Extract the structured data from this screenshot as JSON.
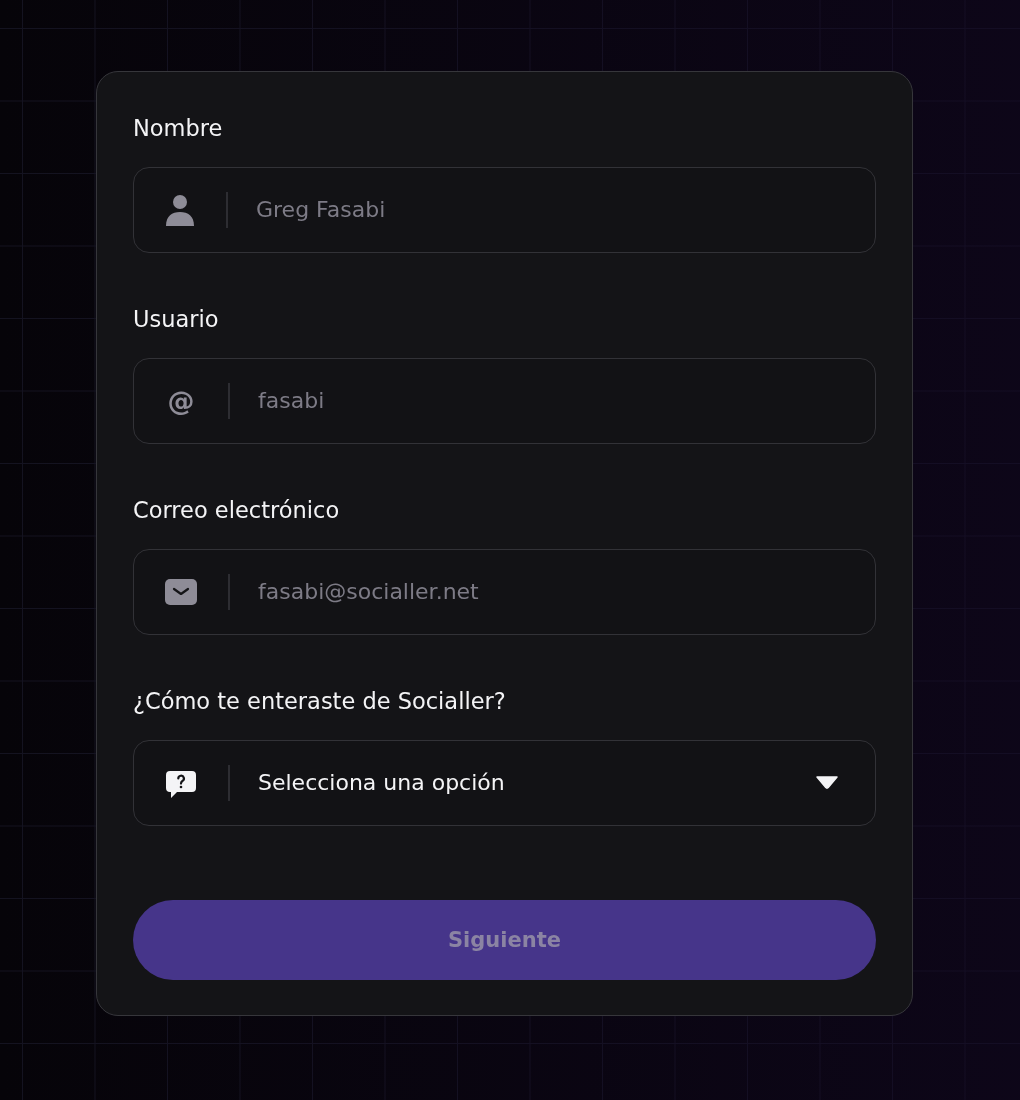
{
  "fields": [
    {
      "kind": "name",
      "label": "Nombre",
      "placeholder": "Greg Fasabi"
    },
    {
      "kind": "username",
      "label": "Usuario",
      "prefix": "@",
      "placeholder": "fasabi"
    },
    {
      "kind": "email",
      "label": "Correo electrónico",
      "placeholder": "fasabi@socialler.net"
    },
    {
      "kind": "select",
      "label": "¿Cómo te enteraste de Socialler?",
      "value": "Selecciona una opción"
    }
  ],
  "button": {
    "label": "Siguiente",
    "disabled": true
  }
}
